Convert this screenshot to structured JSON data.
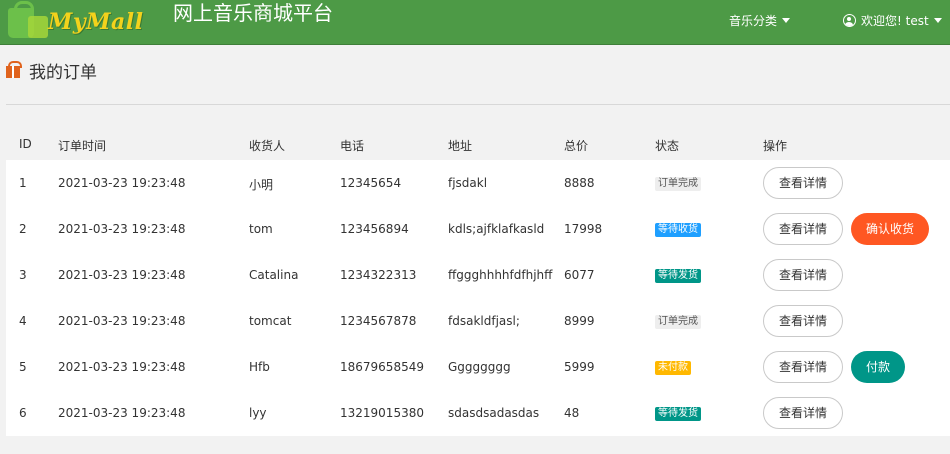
{
  "header": {
    "logo_text": "MyMall",
    "site_title": "网上音乐商城平台",
    "nav_music": "音乐分类",
    "nav_user": "欢迎您! test"
  },
  "page": {
    "title": "我的订单"
  },
  "table": {
    "columns": [
      "ID",
      "订单时间",
      "收货人",
      "电话",
      "地址",
      "总价",
      "状态",
      "操作"
    ],
    "detail_label": "查看详情",
    "rows": [
      {
        "id": "1",
        "time": "2021-03-23 19:23:48",
        "receiver": "小明",
        "phone": "12345654",
        "address": "fjsdakl",
        "total": "8888",
        "status": "订单完成",
        "status_type": "done",
        "action": ""
      },
      {
        "id": "2",
        "time": "2021-03-23 19:23:48",
        "receiver": "tom",
        "phone": "123456894",
        "address": "kdls;ajfklafkasld",
        "total": "17998",
        "status": "等待收货",
        "status_type": "receive",
        "action": "确认收货",
        "action_type": "confirm"
      },
      {
        "id": "3",
        "time": "2021-03-23 19:23:48",
        "receiver": "Catalina",
        "phone": "1234322313",
        "address": "ffggghhhhfdfhjhff",
        "total": "6077",
        "status": "等待发货",
        "status_type": "ship",
        "action": ""
      },
      {
        "id": "4",
        "time": "2021-03-23 19:23:48",
        "receiver": "tomcat",
        "phone": "1234567878",
        "address": "fdsakldfjasl;",
        "total": "8999",
        "status": "订单完成",
        "status_type": "done",
        "action": ""
      },
      {
        "id": "5",
        "time": "2021-03-23 19:23:48",
        "receiver": "Hfb",
        "phone": "18679658549",
        "address": "Gggggggg",
        "total": "5999",
        "status": "未付款",
        "status_type": "unpaid",
        "action": "付款",
        "action_type": "pay"
      },
      {
        "id": "6",
        "time": "2021-03-23 19:23:48",
        "receiver": "lyy",
        "phone": "13219015380",
        "address": "sdasdsadasdas",
        "total": "48",
        "status": "等待发货",
        "status_type": "ship",
        "action": ""
      }
    ]
  },
  "colors": {
    "header_bg": "#4d9a46",
    "badge_done_bg": "#eeeeee",
    "badge_done_text": "#555555",
    "badge_receive_bg": "#1e9fff",
    "badge_ship_bg": "#009688",
    "badge_unpaid_bg": "#ffb800",
    "confirm_btn": "#ff5722",
    "pay_btn": "#009688"
  },
  "icons": {
    "page_head": "gift-icon",
    "user": "user-circle-icon",
    "dropdown": "caret-down-icon"
  }
}
